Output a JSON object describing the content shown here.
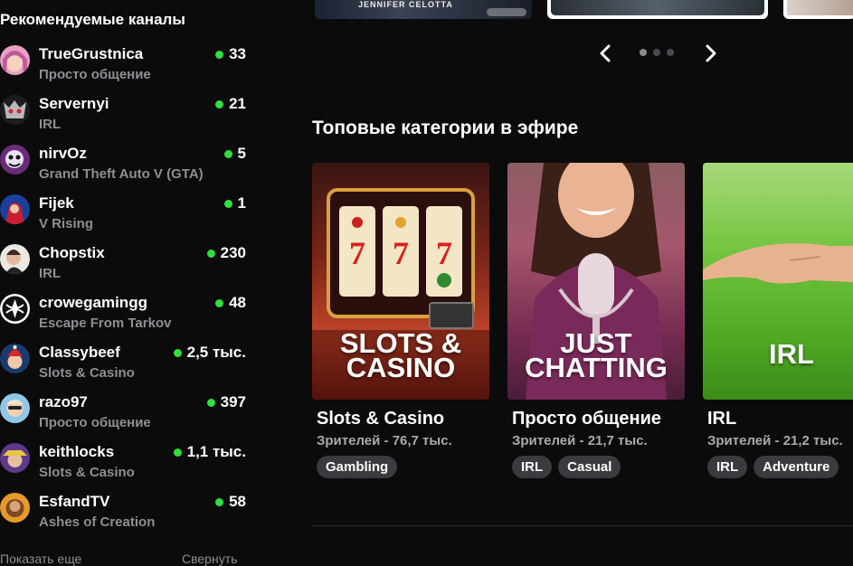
{
  "sidebar": {
    "title": "Рекомендуемые каналы",
    "channels": [
      {
        "name": "TrueGrustnica",
        "category": "Просто общение",
        "viewers": "33"
      },
      {
        "name": "Servernyi",
        "category": "IRL",
        "viewers": "21"
      },
      {
        "name": "nirvOz",
        "category": "Grand Theft Auto V (GTA)",
        "viewers": "5"
      },
      {
        "name": "Fijek",
        "category": "V Rising",
        "viewers": "1"
      },
      {
        "name": "Chopstix",
        "category": "IRL",
        "viewers": "230"
      },
      {
        "name": "crowegamingg",
        "category": "Escape From Tarkov",
        "viewers": "48"
      },
      {
        "name": "Classybeef",
        "category": "Slots & Casino",
        "viewers": "2,5 тыс."
      },
      {
        "name": "razo97",
        "category": "Просто общение",
        "viewers": "397"
      },
      {
        "name": "keithlocks",
        "category": "Slots & Casino",
        "viewers": "1,1 тыс."
      },
      {
        "name": "EsfandTV",
        "category": "Ashes of Creation",
        "viewers": "58"
      }
    ],
    "show_more": "Показать еще",
    "collapse": "Свернуть"
  },
  "carousel": {
    "thumb1_caption": "JENNIFER CELOTTA",
    "page_count": 3,
    "active_page": 1
  },
  "top_categories": {
    "title": "Топовые категории в эфире",
    "items": [
      {
        "name": "Slots & Casino",
        "viewers": "Зрителей - 76,7 тыс.",
        "tags": [
          "Gambling"
        ],
        "cover_line1": "SLOTS &",
        "cover_line2": "CASINO"
      },
      {
        "name": "Просто общение",
        "viewers": "Зрителей - 21,7 тыс.",
        "tags": [
          "IRL",
          "Casual"
        ],
        "cover_line1": "JUST",
        "cover_line2": "CHATTING"
      },
      {
        "name": "IRL",
        "viewers": "Зрителей - 21,2 тыс.",
        "tags": [
          "IRL",
          "Adventure"
        ],
        "cover_line1": "IRL"
      }
    ]
  },
  "colors": {
    "background": "#0b0b0c",
    "live_dot": "#2fe03c",
    "muted_text": "#8e8e94",
    "tag_bg": "#3a3a3f"
  },
  "icons": [
    "chevron-left-icon",
    "chevron-right-icon",
    "live-dot-icon"
  ]
}
